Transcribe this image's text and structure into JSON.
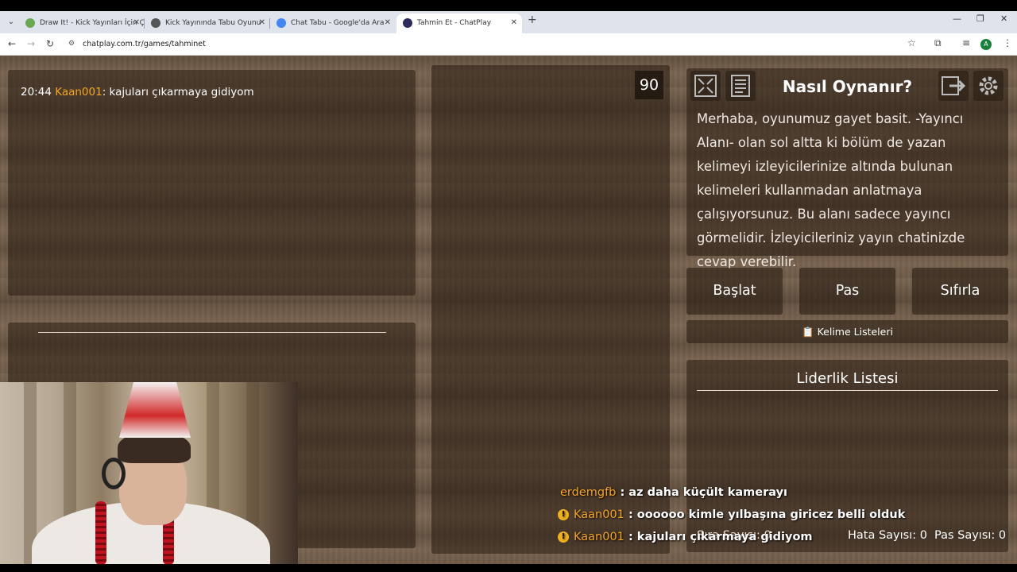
{
  "browser": {
    "tabs": [
      {
        "label": "Draw It! - Kick Yayınları İçin Çizi",
        "fav_color": "#6aa84f"
      },
      {
        "label": "Kick Yayınında Tabu Oyunu",
        "fav_color": "#555555"
      },
      {
        "label": "Chat Tabu - Google'da Ara",
        "fav_color": "#4285f4"
      },
      {
        "label": "Tahmin Et - ChatPlay",
        "fav_color": "#2b2b5c"
      }
    ],
    "url": "chatplay.com.tr/games/tahminet",
    "avatar_letter": "A"
  },
  "chat_panel": {
    "time": "20:44",
    "user": "Kaan001",
    "message": ": kajuları çıkarmaya gidiyom"
  },
  "timer": "90",
  "how_to_play": {
    "title": "Nasıl Oynanır?",
    "text": "Merhaba, oyunumuz gayet basit. -Yayıncı Alanı- olan sol altta ki bölüm de yazan kelimeyi izleyicilerinize altında bulunan kelimeleri kullanmadan anlatmaya çalışıyorsunuz. Bu alanı sadece yayıncı görmelidir. İzleyicileriniz yayın chatinizde cevap verebilir."
  },
  "buttons": {
    "start": "Başlat",
    "pass": "Pas",
    "reset": "Sıfırla",
    "word_lists": "Kelime Listeleri",
    "word_lists_icon": "📋"
  },
  "leaderboard": {
    "title": "Liderlik Listesi"
  },
  "stats": {
    "order": "Sıra Sayısı: 0",
    "errors": "Hata Sayısı: 0",
    "passes": "Pas Sayısı: 0"
  },
  "overlay_chat": [
    {
      "user": "erdemgfb",
      "message": ": az daha küçült kamerayı",
      "badge": false
    },
    {
      "user": "Kaan001",
      "message": ": oooooo kimle yılbaşına giricez belli olduk",
      "badge": true
    },
    {
      "user": "Kaan001",
      "message": ": kajuları çıkarmaya gidiyom",
      "badge": true
    }
  ],
  "colors": {
    "username": "#f5a623",
    "wood": "#6e5a47"
  }
}
